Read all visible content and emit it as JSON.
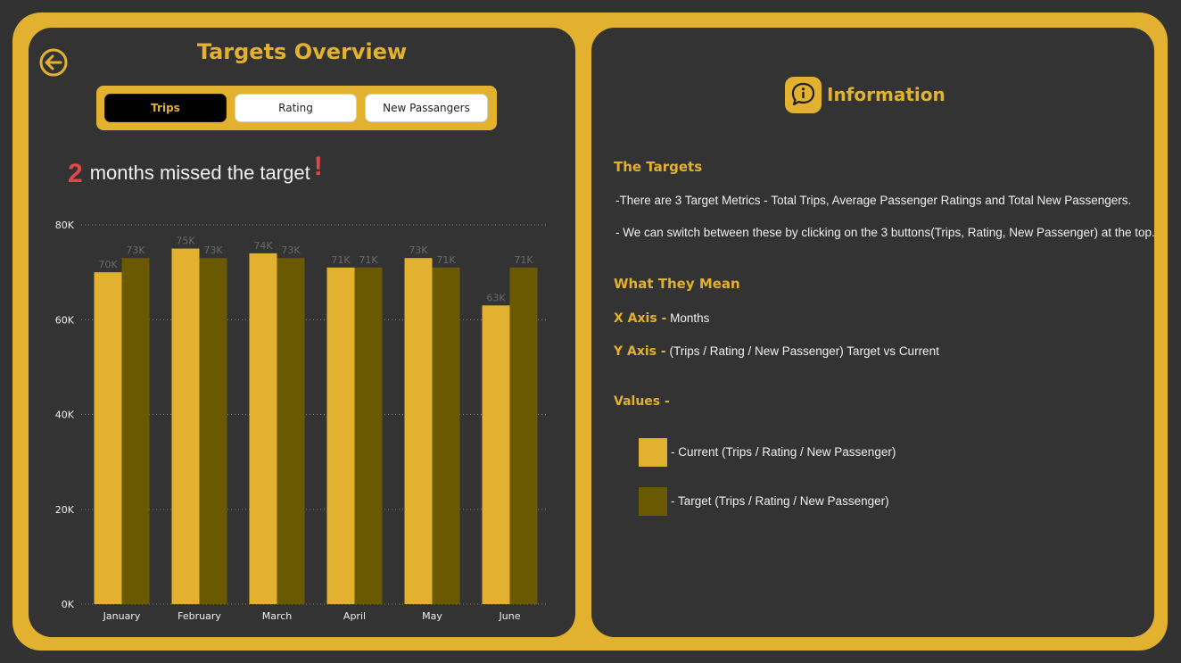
{
  "header": {
    "title": "Targets Overview",
    "tabs": [
      {
        "label": "Trips",
        "active": true
      },
      {
        "label": "Rating",
        "active": false
      },
      {
        "label": "New Passangers",
        "active": false
      }
    ]
  },
  "summary": {
    "missed_count": "2",
    "missed_text": "months missed the target",
    "exclamation": "!"
  },
  "colors": {
    "accent": "#e2b12f",
    "current": "#e2b12f",
    "target": "#6b5900",
    "panel": "#333333",
    "alert": "#e0464a"
  },
  "chart_data": {
    "type": "bar",
    "categories": [
      "January",
      "February",
      "March",
      "April",
      "May",
      "June"
    ],
    "series": [
      {
        "values": [
          70,
          75,
          74,
          71,
          73,
          63
        ],
        "labels": [
          "70K",
          "75K",
          "74K",
          "71K",
          "73K",
          "63K"
        ]
      },
      {
        "values": [
          73,
          73,
          73,
          71,
          71,
          71
        ],
        "labels": [
          "73K",
          "73K",
          "73K",
          "71K",
          "71K",
          "71K"
        ]
      }
    ],
    "yticks": [
      "0K",
      "20K",
      "40K",
      "60K",
      "80K"
    ],
    "ylim": [
      0,
      80
    ],
    "unit": "K",
    "grid": true
  },
  "info": {
    "title": "Information",
    "icon": "info-bubble-icon",
    "targets_heading": "The Targets",
    "targets_line1": "-There are 3 Target Metrics - Total Trips, Average Passenger Ratings and Total New Passengers.",
    "targets_line2": "- We can switch between these by clicking on the 3 buttons(Trips, Rating, New Passenger) at the top.",
    "meaning_heading": "What They Mean",
    "x_label": "X Axis -",
    "x_value": "Months",
    "y_label": "Y Axis -",
    "y_value": "(Trips / Rating / New Passenger) Target vs Current",
    "values_heading": "Values -",
    "legend_current": "- Current (Trips / Rating / New Passenger)",
    "legend_target": "- Target (Trips / Rating / New Passenger)"
  }
}
